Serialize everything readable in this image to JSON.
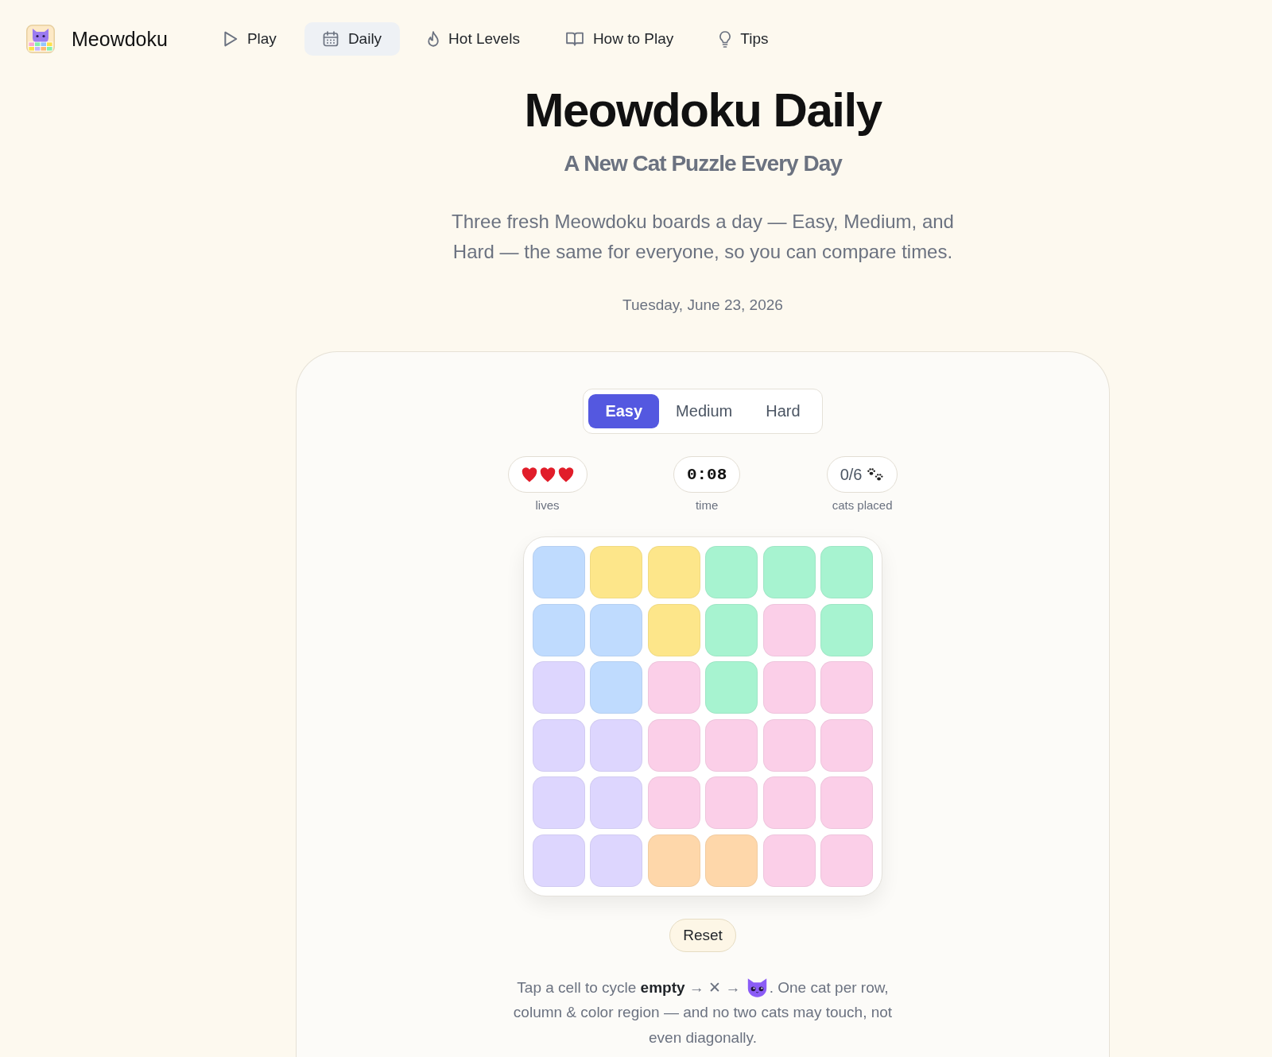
{
  "nav": {
    "brand": "Meowdoku",
    "items": [
      {
        "label": "Play",
        "selected": false
      },
      {
        "label": "Daily",
        "selected": true
      },
      {
        "label": "Hot Levels",
        "selected": false
      },
      {
        "label": "How to Play",
        "selected": false
      },
      {
        "label": "Tips",
        "selected": false
      }
    ]
  },
  "hero": {
    "title": "Meowdoku Daily",
    "subtitle": "A New Cat Puzzle Every Day",
    "description": "Three fresh Meowdoku boards a day — Easy, Medium, and Hard — the same for everyone, so you can compare times.",
    "date": "Tuesday, June 23, 2026"
  },
  "game": {
    "difficulty_tabs": [
      {
        "label": "Easy",
        "selected": true
      },
      {
        "label": "Medium",
        "selected": false
      },
      {
        "label": "Hard",
        "selected": false
      }
    ],
    "stats": [
      {
        "kind": "hearts",
        "hearts": [
          {
            "filled": true
          },
          {
            "filled": true
          },
          {
            "filled": true
          }
        ],
        "label": "lives"
      },
      {
        "kind": "timer",
        "value": "0:08",
        "label": "time"
      },
      {
        "kind": "count",
        "value": "0/6",
        "label": "cats placed"
      }
    ],
    "board": {
      "rows": [
        [
          {
            "color": "#bfdbfe"
          },
          {
            "color": "#fde68a"
          },
          {
            "color": "#fde68a"
          },
          {
            "color": "#a7f3d0"
          },
          {
            "color": "#a7f3d0"
          },
          {
            "color": "#a7f3d0"
          }
        ],
        [
          {
            "color": "#bfdbfe"
          },
          {
            "color": "#bfdbfe"
          },
          {
            "color": "#fde68a"
          },
          {
            "color": "#a7f3d0"
          },
          {
            "color": "#fbcfe8"
          },
          {
            "color": "#a7f3d0"
          }
        ],
        [
          {
            "color": "#ddd6fe"
          },
          {
            "color": "#bfdbfe"
          },
          {
            "color": "#fbcfe8"
          },
          {
            "color": "#a7f3d0"
          },
          {
            "color": "#fbcfe8"
          },
          {
            "color": "#fbcfe8"
          }
        ],
        [
          {
            "color": "#ddd6fe"
          },
          {
            "color": "#ddd6fe"
          },
          {
            "color": "#fbcfe8"
          },
          {
            "color": "#fbcfe8"
          },
          {
            "color": "#fbcfe8"
          },
          {
            "color": "#fbcfe8"
          }
        ],
        [
          {
            "color": "#ddd6fe"
          },
          {
            "color": "#ddd6fe"
          },
          {
            "color": "#fbcfe8"
          },
          {
            "color": "#fbcfe8"
          },
          {
            "color": "#fbcfe8"
          },
          {
            "color": "#fbcfe8"
          }
        ],
        [
          {
            "color": "#ddd6fe"
          },
          {
            "color": "#ddd6fe"
          },
          {
            "color": "#fed7aa"
          },
          {
            "color": "#fed7aa"
          },
          {
            "color": "#fbcfe8"
          },
          {
            "color": "#fbcfe8"
          }
        ]
      ]
    },
    "reset_button": "Reset",
    "instructions": {
      "before": "Tap a cell to cycle **empty** → ✕ →",
      "after": ". One cat per row, column & color region — and no two cats may touch, not even diagonally."
    }
  }
}
